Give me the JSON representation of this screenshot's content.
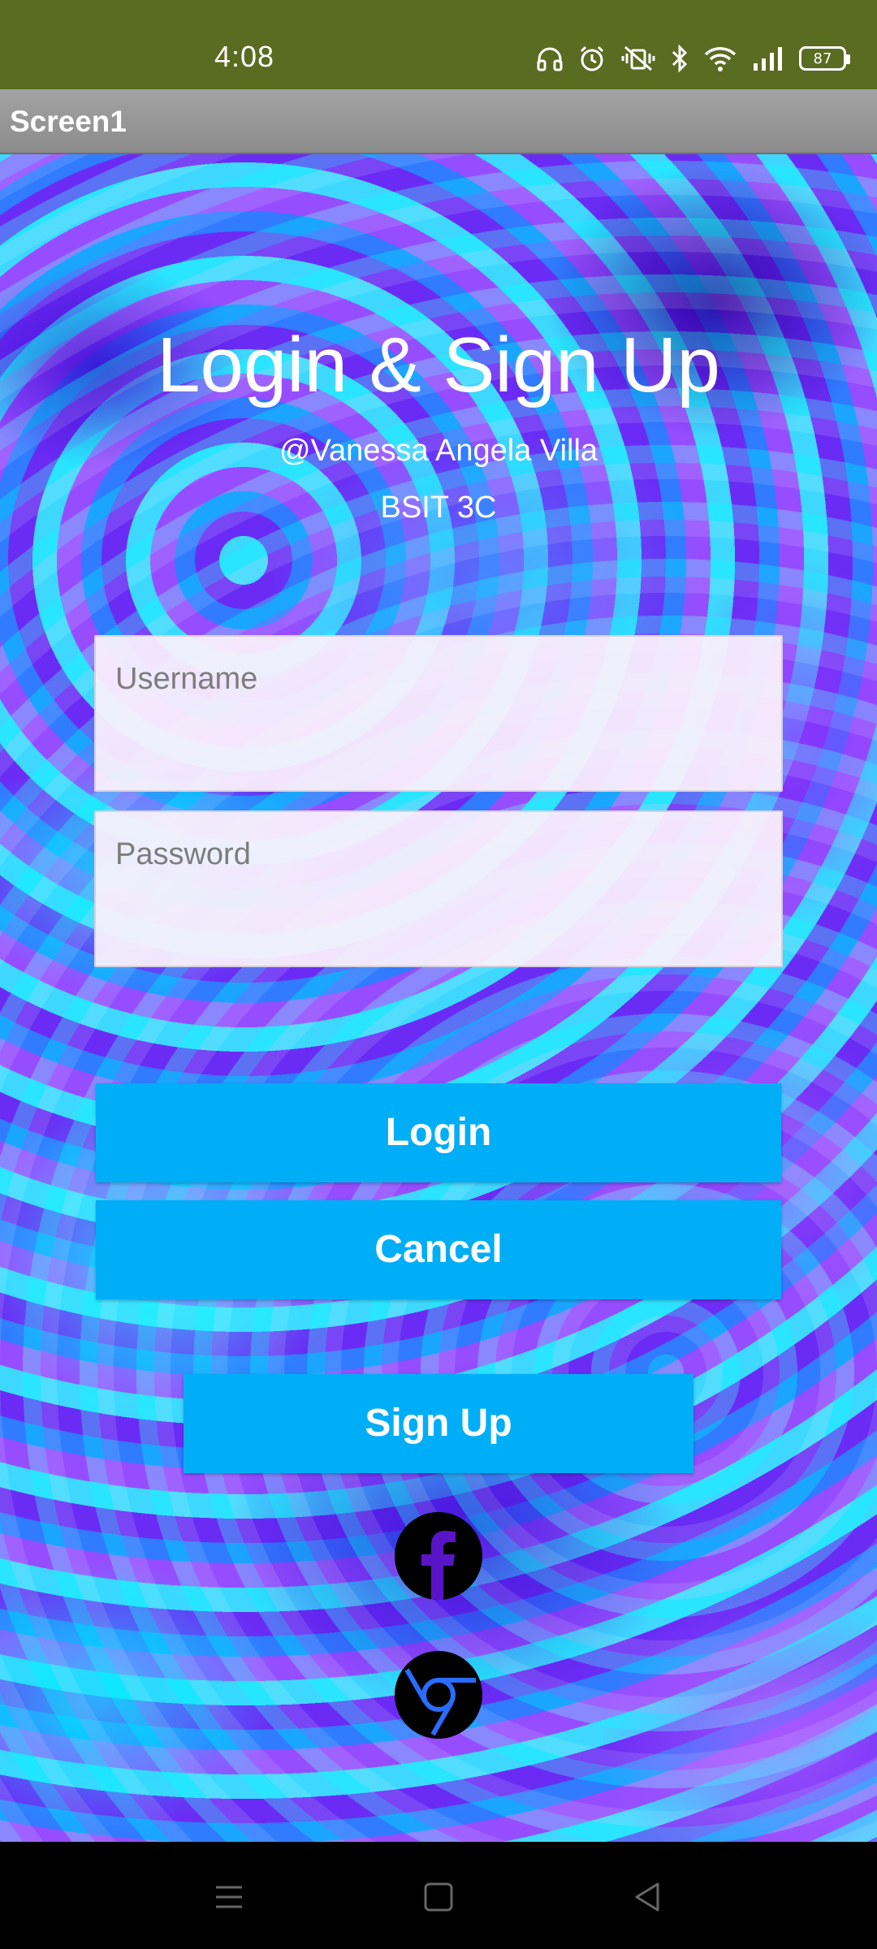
{
  "status_bar": {
    "time": "4:08",
    "battery": "87",
    "icons": [
      "headphones-icon",
      "alarm-icon",
      "vibrate-mute-icon",
      "bluetooth-icon",
      "wifi-icon",
      "signal-icon",
      "battery-icon"
    ]
  },
  "title_bar": {
    "title": "Screen1"
  },
  "header": {
    "title": "Login & Sign Up",
    "author": "@Vanessa Angela Villa",
    "section": "BSIT 3C"
  },
  "form": {
    "username": {
      "placeholder": "Username",
      "value": ""
    },
    "password": {
      "placeholder": "Password",
      "value": ""
    }
  },
  "buttons": {
    "login": "Login",
    "cancel": "Cancel",
    "signup": "Sign Up"
  },
  "social": [
    "facebook-icon",
    "chrome-icon"
  ],
  "colors": {
    "status_bar": "#5a6b22",
    "title_bar": "#999999",
    "button": "#00adf7"
  }
}
